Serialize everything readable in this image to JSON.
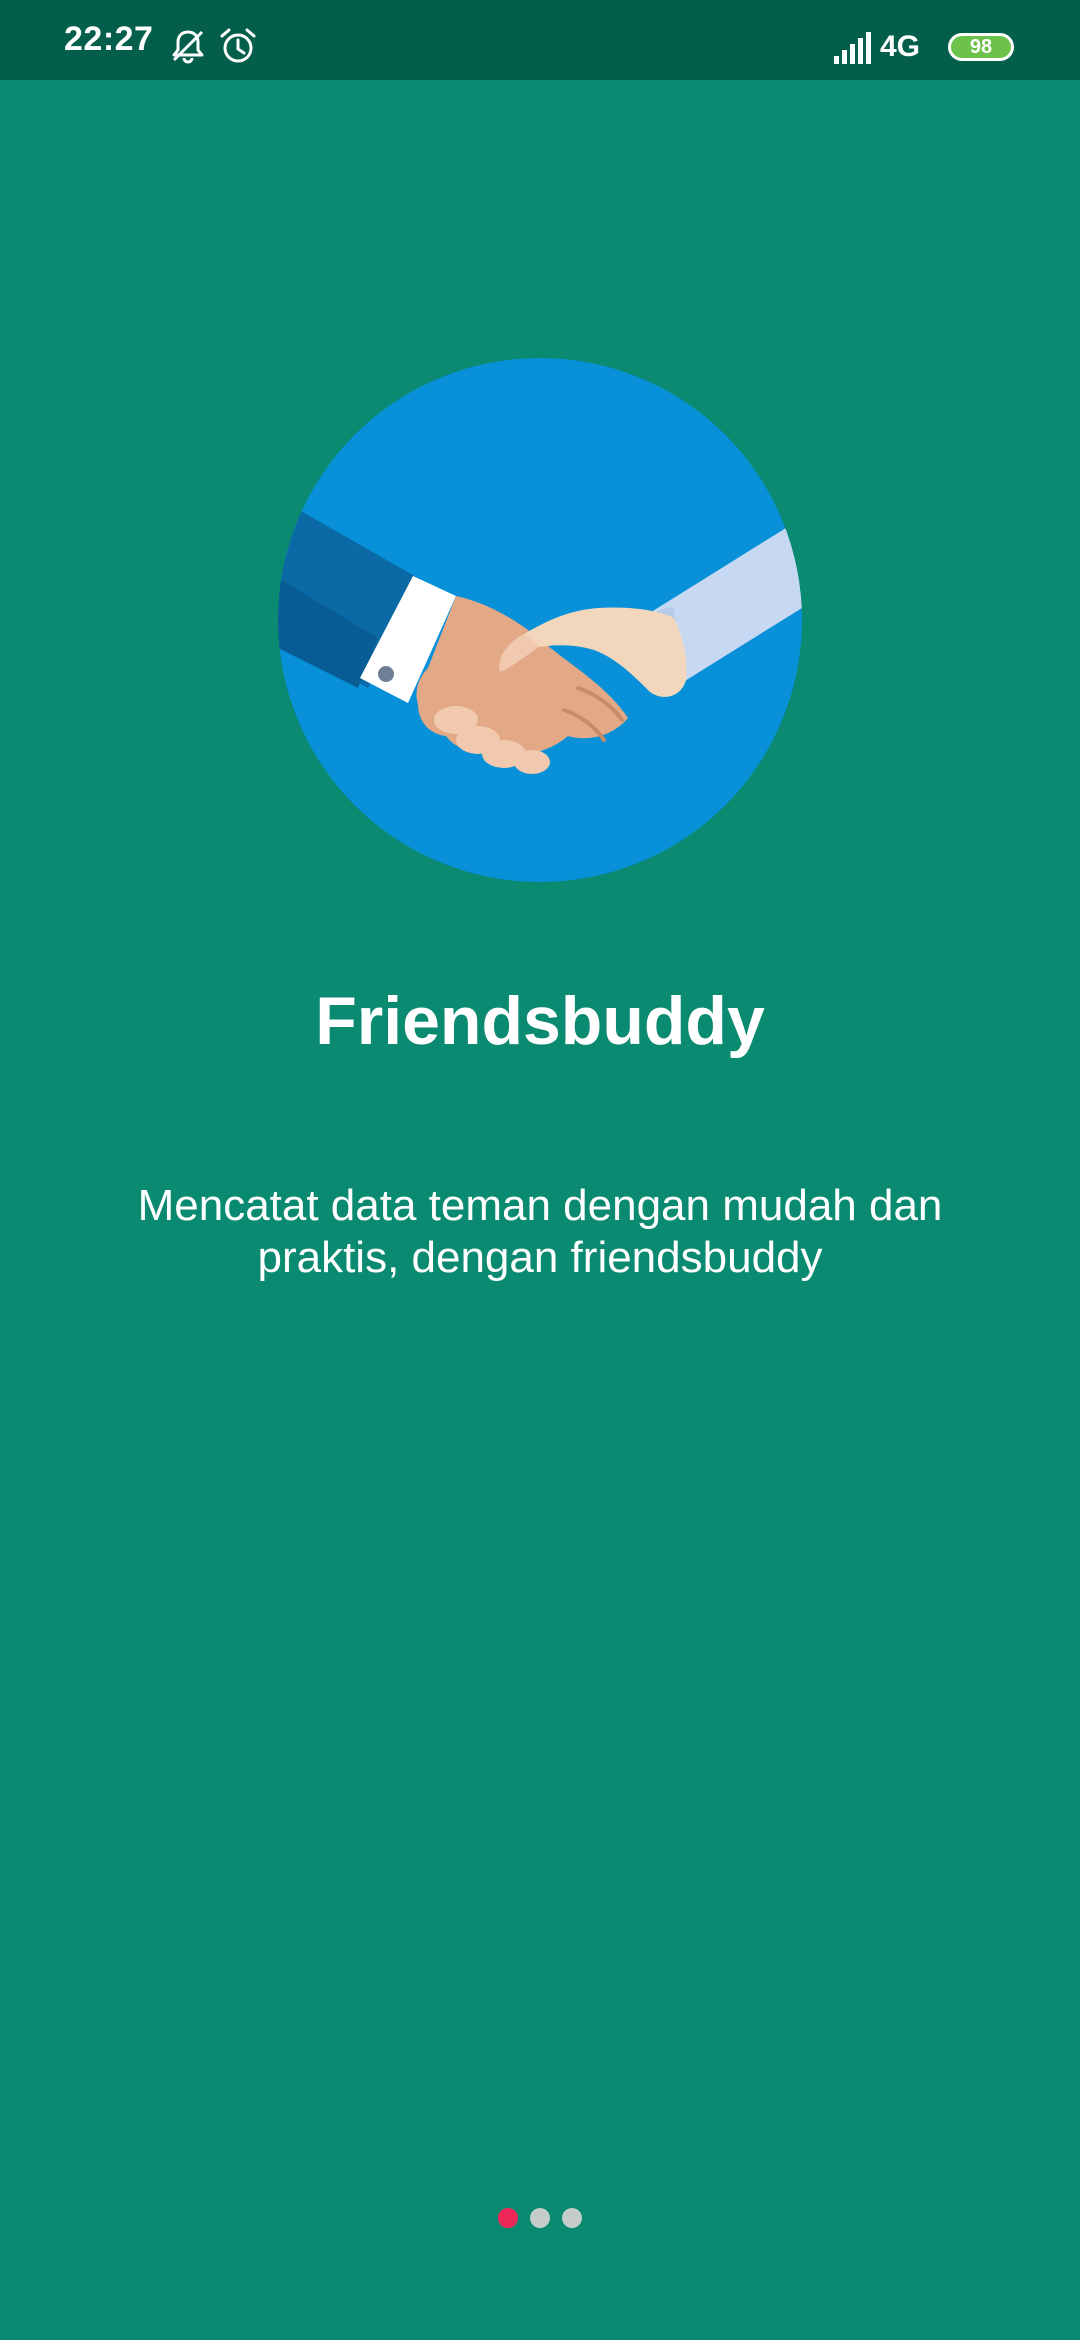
{
  "status_bar": {
    "time": "22:27",
    "network": "4G",
    "battery_level": "98",
    "icons": [
      "bell-off-icon",
      "alarm-icon",
      "signal-icon",
      "battery-icon"
    ]
  },
  "onboarding": {
    "title": "Friendsbuddy",
    "description": "Mencatat data teman dengan mudah dan praktis, dengan friendsbuddy",
    "hero_image": "handshake-illustration",
    "pages_total": 3,
    "current_page": 1
  },
  "colors": {
    "background": "#0a8a70",
    "status_bar": "#035f4c",
    "circle": "#0890d8",
    "indicator_active": "#f0285a",
    "indicator_inactive": "#c6ccca"
  }
}
